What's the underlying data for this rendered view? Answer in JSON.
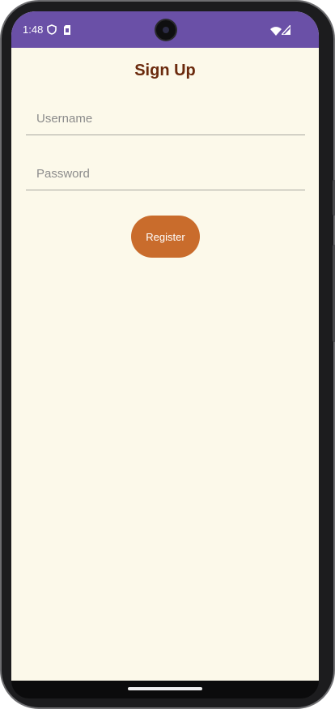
{
  "status_bar": {
    "time": "1:48",
    "left_icons": [
      "shield-icon",
      "sim-card-icon"
    ],
    "right_icons": [
      "wifi-icon",
      "signal-icon"
    ],
    "color": "#6a50a7"
  },
  "screen": {
    "background": "#fcf9ea",
    "title": "Sign Up"
  },
  "form": {
    "username_placeholder": "Username",
    "username_value": "",
    "password_placeholder": "Password",
    "password_value": "",
    "register_label": "Register",
    "button_color": "#c96c2c"
  }
}
